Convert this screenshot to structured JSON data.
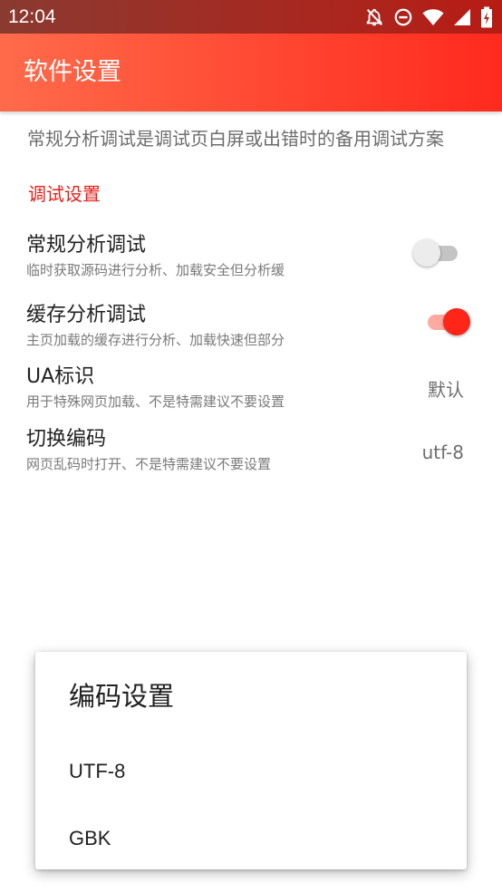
{
  "status_bar": {
    "time": "12:04",
    "icons": [
      "notifications-off-icon",
      "do-not-disturb-icon",
      "wifi-icon",
      "cell-signal-icon",
      "battery-icon"
    ]
  },
  "app_bar": {
    "title": "软件设置"
  },
  "note": "常规分析调试是调试页白屏或出错时的备用调试方案",
  "category": "调试设置",
  "preferences": [
    {
      "title": "常规分析调试",
      "summary": "临时获取源码进行分析、加载安全但分析缓",
      "type": "switch",
      "checked": false
    },
    {
      "title": "缓存分析调试",
      "summary": "主页加载的缓存进行分析、加载快速但部分",
      "type": "switch",
      "checked": true
    },
    {
      "title": "UA标识",
      "summary": "用于特殊网页加载、不是特需建议不要设置",
      "type": "value",
      "value": "默认"
    },
    {
      "title": "切换编码",
      "summary": "网页乱码时打开、不是特需建议不要设置",
      "type": "value",
      "value": "utf-8"
    }
  ],
  "dialog": {
    "title": "编码设置",
    "options": [
      "UTF-8",
      "GBK"
    ]
  },
  "colors": {
    "accent": "#ff2518",
    "category_text": "#e5201a",
    "app_bar_start": "#ff6b4a",
    "app_bar_end": "#ff2a1e",
    "status_bar": "#a52a22"
  }
}
